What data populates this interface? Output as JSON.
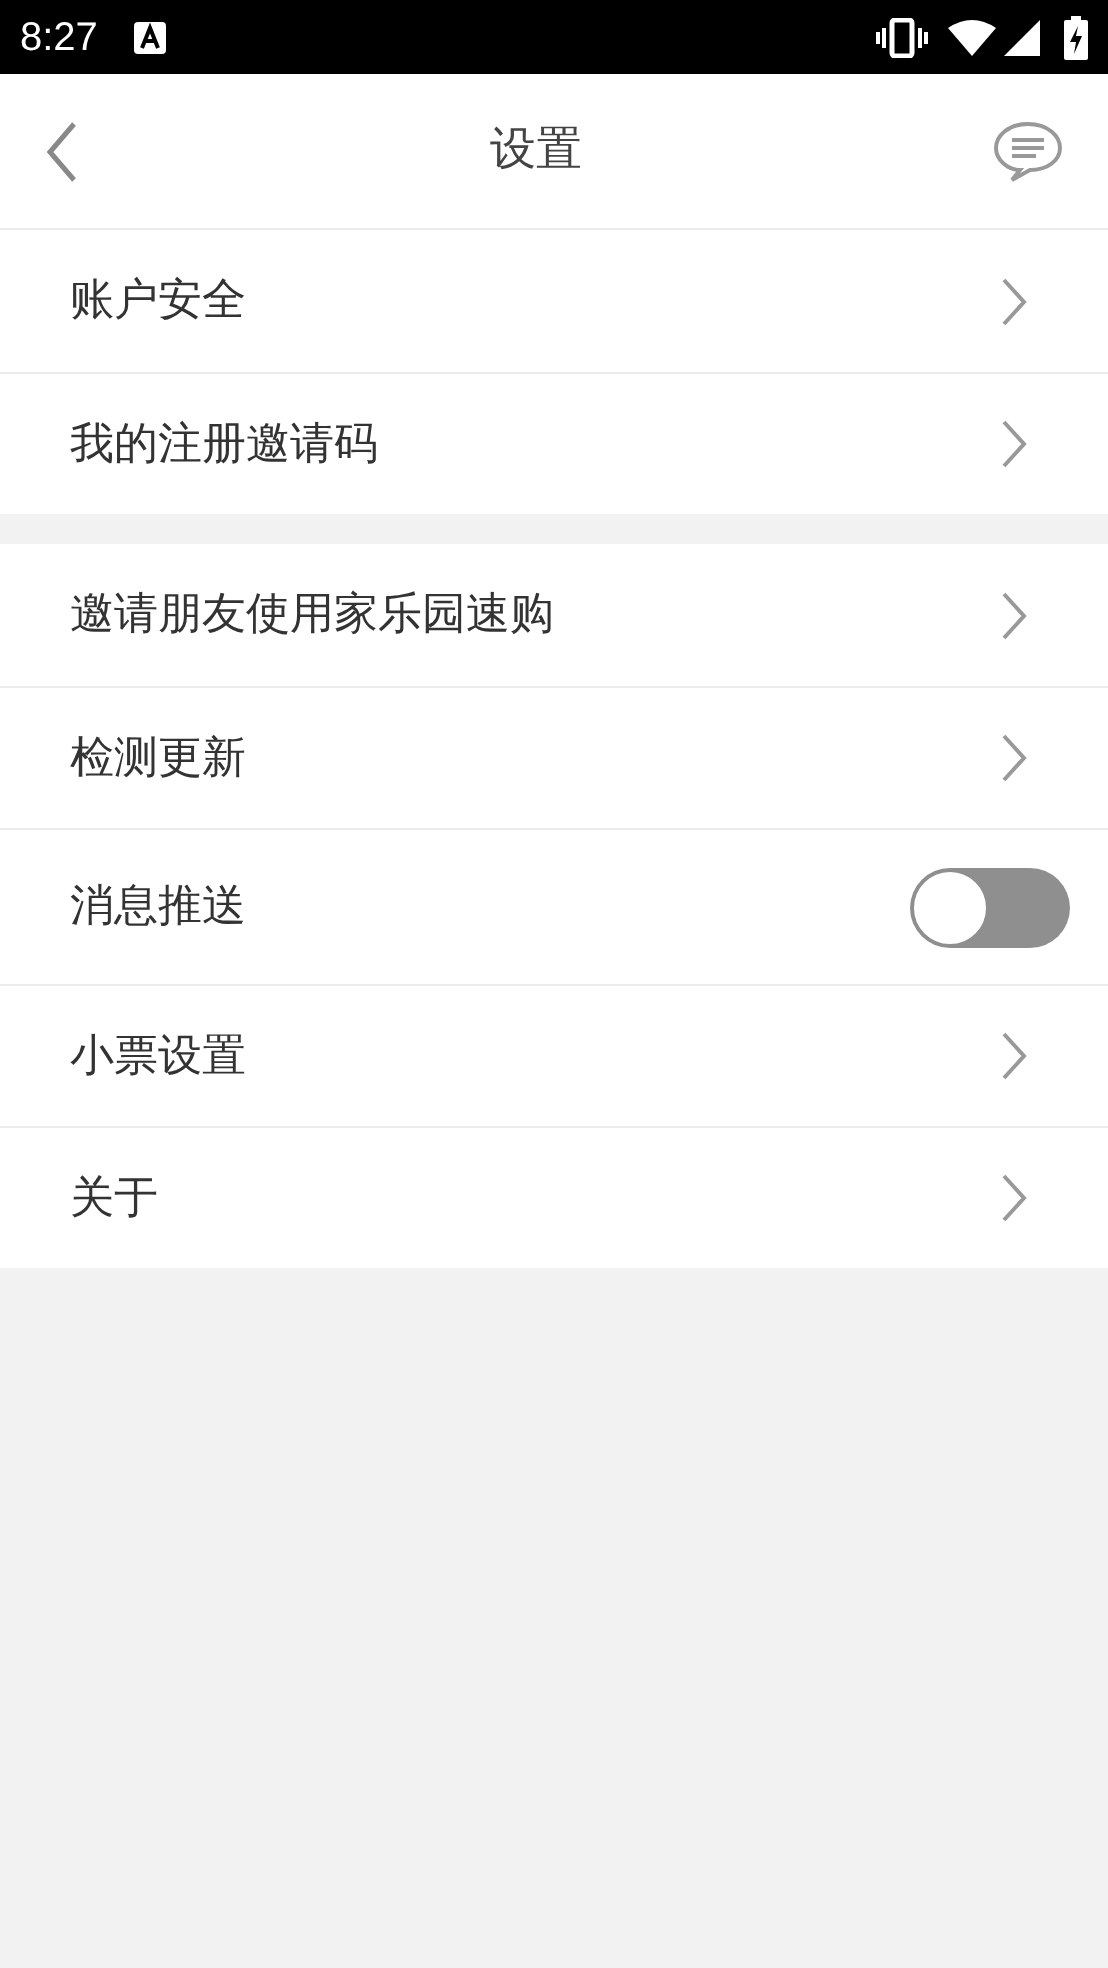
{
  "status_bar": {
    "time": "8:27"
  },
  "header": {
    "title": "设置"
  },
  "groups": [
    {
      "items": [
        {
          "kind": "link",
          "label": "账户安全"
        },
        {
          "kind": "link",
          "label": "我的注册邀请码"
        }
      ]
    },
    {
      "items": [
        {
          "kind": "link",
          "label": "邀请朋友使用家乐园速购"
        },
        {
          "kind": "link",
          "label": "检测更新"
        },
        {
          "kind": "toggle",
          "label": "消息推送",
          "on": false
        },
        {
          "kind": "link",
          "label": "小票设置"
        },
        {
          "kind": "link",
          "label": "关于"
        }
      ]
    }
  ]
}
